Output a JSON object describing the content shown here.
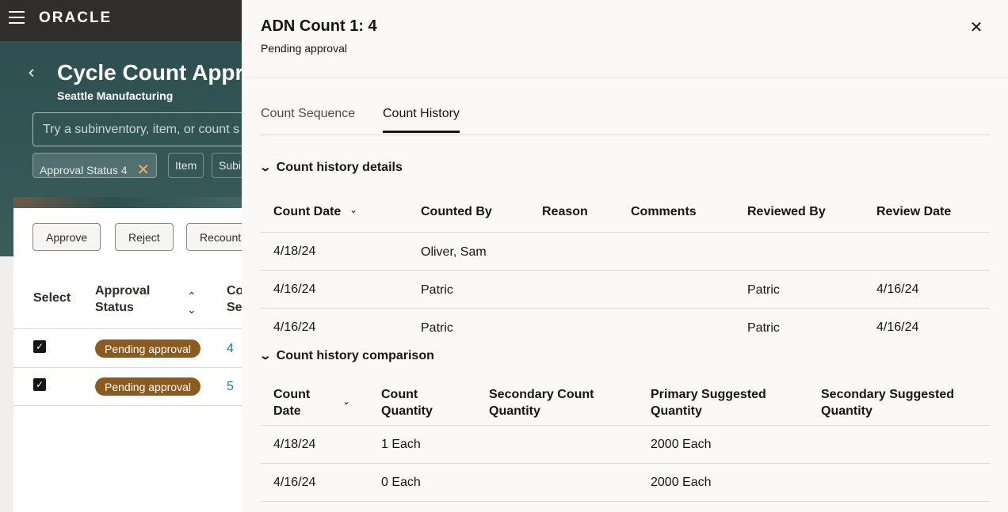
{
  "app": {
    "logo": "ORACLE"
  },
  "page": {
    "title": "Cycle Count Appr",
    "subtitle": "Seattle Manufacturing",
    "search_placeholder": "Try a subinventory, item, or count s",
    "filters": [
      {
        "label": "Approval Status",
        "count": "4"
      },
      {
        "label": "Item"
      },
      {
        "label": "Subi"
      }
    ],
    "actions": [
      "Approve",
      "Reject",
      "Recount"
    ],
    "table": {
      "headers": {
        "select": "Select",
        "approval": "Approval Status",
        "seq": "Co Se"
      },
      "rows": [
        {
          "checked": true,
          "status": "Pending approval",
          "seq": "4"
        },
        {
          "checked": true,
          "status": "Pending approval",
          "seq": "5"
        }
      ]
    }
  },
  "drawer": {
    "title": "ADN Count 1: 4",
    "subtitle": "Pending approval",
    "tabs": [
      "Count Sequence",
      "Count History"
    ],
    "active_tab": "Count History",
    "history": {
      "section_label": "Count history details",
      "headers": [
        "Count Date",
        "Counted By",
        "Reason",
        "Comments",
        "Reviewed By",
        "Review Date"
      ],
      "rows": [
        {
          "count_date": "4/18/24",
          "counted_by": "Oliver, Sam",
          "reason": "",
          "comments": "",
          "reviewed_by": "",
          "review_date": ""
        },
        {
          "count_date": "4/16/24",
          "counted_by": "Patric",
          "reason": "",
          "comments": "",
          "reviewed_by": "Patric",
          "review_date": "4/16/24"
        },
        {
          "count_date": "4/16/24",
          "counted_by": "Patric",
          "reason": "",
          "comments": "",
          "reviewed_by": "Patric",
          "review_date": "4/16/24"
        }
      ]
    },
    "comparison": {
      "section_label": "Count history comparison",
      "headers": [
        {
          "line1": "Count",
          "line2": "Date"
        },
        {
          "line1": "Count",
          "line2": "Quantity"
        },
        {
          "line1": "Secondary Count",
          "line2": "Quantity"
        },
        {
          "line1": "Primary Suggested",
          "line2": "Quantity"
        },
        {
          "line1": "Secondary Suggested",
          "line2": "Quantity"
        }
      ],
      "rows": [
        {
          "count_date": "4/18/24",
          "count_qty": "1 Each",
          "secondary_count_qty": "",
          "primary_suggested": "2000 Each",
          "secondary_suggested": ""
        },
        {
          "count_date": "4/16/24",
          "count_qty": "0 Each",
          "secondary_count_qty": "",
          "primary_suggested": "2000 Each",
          "secondary_suggested": ""
        }
      ]
    }
  },
  "colors": {
    "header_bg": "#312d2a",
    "hero_bg": "#2d4f50",
    "badge_bg": "#8b5a1e",
    "link": "#227e9e",
    "drawer_bg": "#fbf9f8"
  }
}
